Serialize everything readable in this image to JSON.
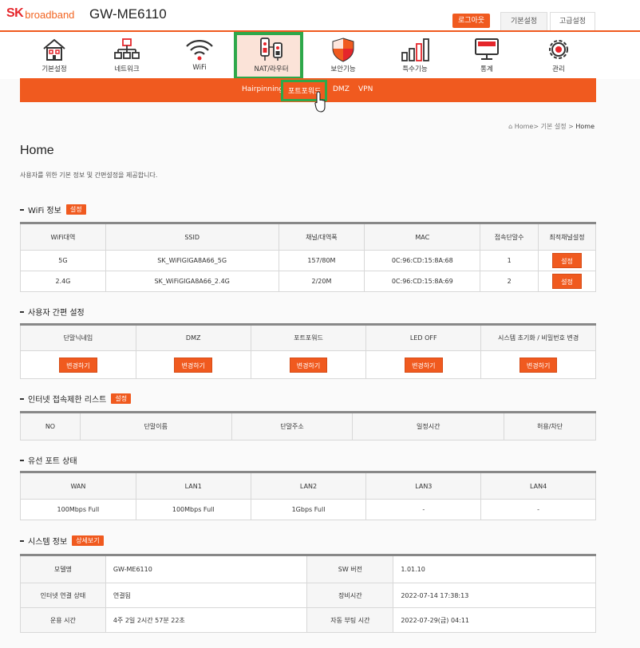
{
  "header": {
    "logo_sk": "SK",
    "logo_broadband": "broadband",
    "model": "GW-ME6110",
    "logout": "로그아웃",
    "tab_basic": "기본설정",
    "tab_advanced": "고급설정"
  },
  "menu": [
    {
      "label": "기본설정",
      "icon": "home-icon"
    },
    {
      "label": "네트워크",
      "icon": "network-icon"
    },
    {
      "label": "WiFi",
      "icon": "wifi-icon"
    },
    {
      "label": "NAT/라우터",
      "icon": "nat-router-icon"
    },
    {
      "label": "보안기능",
      "icon": "shield-icon"
    },
    {
      "label": "특수기능",
      "icon": "bar-chart-icon"
    },
    {
      "label": "통계",
      "icon": "monitor-icon"
    },
    {
      "label": "관리",
      "icon": "gear-icon"
    }
  ],
  "submenu": [
    "Hairpinning",
    "포트포워드",
    "DMZ",
    "VPN"
  ],
  "breadcrumb": {
    "home": "Home",
    "sep": ">",
    "basic": "기본 설정",
    "current": "Home"
  },
  "page": {
    "title": "Home",
    "desc": "사용자를 위한 기본 정보 및 간편설정을 제공합니다."
  },
  "wifi": {
    "title": "WiFi 정보",
    "badge": "설정",
    "headers": [
      "WiFi대역",
      "SSID",
      "채널/대역폭",
      "MAC",
      "접속단말수",
      "최적채널설정"
    ],
    "rows": [
      {
        "band": "5G",
        "ssid": "SK_WiFiGIGA8A66_5G",
        "channel": "157/80M",
        "mac": "0C:96:CD:15:8A:68",
        "clients": "1",
        "btn": "설정"
      },
      {
        "band": "2.4G",
        "ssid": "SK_WiFiGIGA8A66_2.4G",
        "channel": "2/20M",
        "mac": "0C:96:CD:15:8A:69",
        "clients": "2",
        "btn": "설정"
      }
    ]
  },
  "quick": {
    "title": "사용자 간편 설정",
    "headers": [
      "단말닉네임",
      "DMZ",
      "포트포워드",
      "LED OFF",
      "시스템 초기화 / 비밀번호 변경"
    ],
    "btn": "변경하기"
  },
  "blocklist": {
    "title": "인터넷 접속제한 리스트",
    "badge": "설정",
    "headers": [
      "NO",
      "단말이름",
      "단말주소",
      "일정시간",
      "허용/차단"
    ]
  },
  "ports": {
    "title": "유선 포트 상태",
    "headers": [
      "WAN",
      "LAN1",
      "LAN2",
      "LAN3",
      "LAN4"
    ],
    "values": [
      "100Mbps Full",
      "100Mbps Full",
      "1Gbps Full",
      "-",
      "-"
    ]
  },
  "system": {
    "title": "시스템 정보",
    "badge": "상세보기",
    "rows": [
      {
        "l1": "모델명",
        "v1": "GW-ME6110",
        "l2": "SW 버전",
        "v2": "1.01.10"
      },
      {
        "l1": "인터넷 연결 상태",
        "v1": "연결됨",
        "l2": "장비시간",
        "v2": "2022-07-14 17:38:13"
      },
      {
        "l1": "운용 시간",
        "v1": "4주 2일 2시간 57분 22초",
        "l2": "자동 부팅 시간",
        "v2": "2022-07-29(금) 04:11"
      }
    ]
  },
  "colors": {
    "accent": "#f05a1f",
    "highlight": "#2ea84a"
  }
}
